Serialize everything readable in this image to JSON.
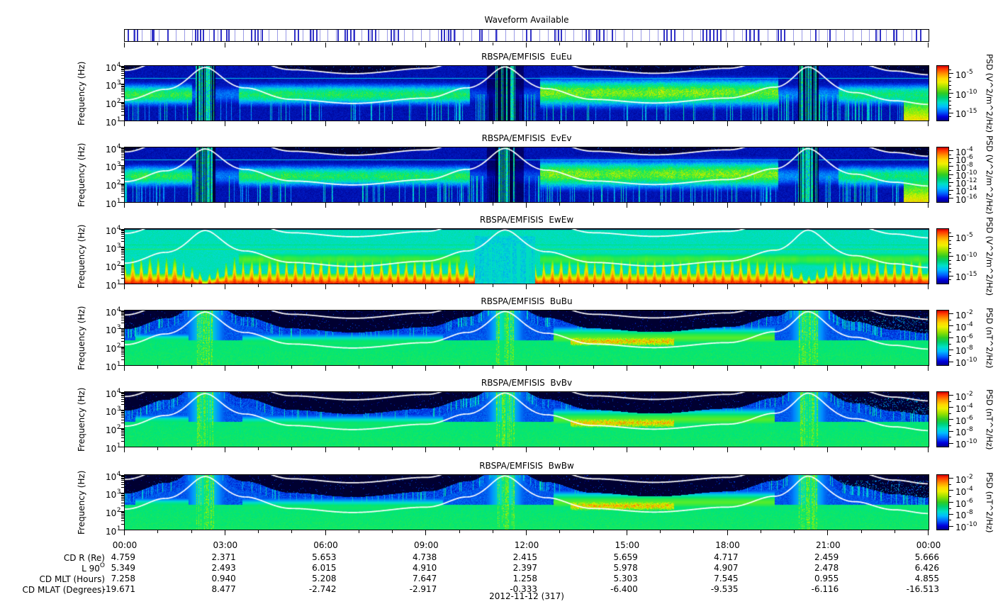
{
  "pow_base": "10",
  "waveform": {
    "title": "Waveform Available",
    "grid_color": "#9a9ae6",
    "mark_color": "#3434c8",
    "num_cells": 95,
    "marks": [
      0.004,
      0.012,
      0.016,
      0.034,
      0.036,
      0.054,
      0.088,
      0.091,
      0.094,
      0.098,
      0.111,
      0.12,
      0.127,
      0.13,
      0.158,
      0.162,
      0.166,
      0.171,
      0.212,
      0.216,
      0.231,
      0.235,
      0.239,
      0.265,
      0.274,
      0.277,
      0.281,
      0.286,
      0.303,
      0.308,
      0.312,
      0.332,
      0.335,
      0.34,
      0.394,
      0.398,
      0.403,
      0.406,
      0.41,
      0.442,
      0.444,
      0.462,
      0.5,
      0.505,
      0.535,
      0.54,
      0.543,
      0.574,
      0.578,
      0.587,
      0.591,
      0.596,
      0.607,
      0.671,
      0.675,
      0.68,
      0.684,
      0.72,
      0.724,
      0.728,
      0.733,
      0.737,
      0.742,
      0.773,
      0.778,
      0.783,
      0.788,
      0.813,
      0.817,
      0.821,
      0.86,
      0.877,
      0.935,
      0.94,
      0.957,
      0.96,
      0.985,
      0.99
    ]
  },
  "freq_axis": {
    "label": "Frequency (Hz)",
    "ticks": [
      {
        "base": "10",
        "exp": "4"
      },
      {
        "base": "10",
        "exp": "3"
      },
      {
        "base": "10",
        "exp": "2"
      },
      {
        "base": "10",
        "exp": "1"
      }
    ]
  },
  "time_axis": {
    "labels": [
      "00:00",
      "03:00",
      "06:00",
      "09:00",
      "12:00",
      "15:00",
      "18:00",
      "21:00",
      "00:00"
    ]
  },
  "chart_data": {
    "type": "heatmap",
    "description": "Stack of six RBSP-A EMFISIS wave power spectral density spectrograms vs time (00:00-24:00 UT) and log frequency (10 Hz - 10 kHz), with a waveform-availability event strip on top and spacecraft ephemeris rows below the time axis.",
    "x_range_hours": [
      0,
      24
    ],
    "date": "2012-11-12 (317)",
    "overlay_curves": {
      "description": "white curves: electron cyclotron frequency fce and lower-hybrid frequency fce/43",
      "fce_coeff_hz": 873600,
      "flh_ratio": 43,
      "L_control_points": [
        [
          0,
          5.349
        ],
        [
          1.2,
          3.4
        ],
        [
          2.4,
          1.35
        ],
        [
          3.6,
          3.2
        ],
        [
          5.0,
          5.2
        ],
        [
          6.8,
          6.15
        ],
        [
          9.0,
          4.91
        ],
        [
          10.2,
          3.2
        ],
        [
          11.35,
          1.32
        ],
        [
          12.6,
          3.3
        ],
        [
          14.0,
          5.2
        ],
        [
          15.8,
          6.05
        ],
        [
          18.0,
          4.907
        ],
        [
          19.4,
          3.1
        ],
        [
          20.4,
          1.33
        ],
        [
          21.8,
          3.9
        ],
        [
          23.0,
          5.5
        ],
        [
          24.0,
          6.426
        ]
      ]
    },
    "events": {
      "perigee_hours": [
        2.4,
        11.35,
        20.4
      ],
      "enhanced_wave_patch_hours": [
        13.0,
        19.3
      ]
    },
    "panels": [
      {
        "type": "heatmap",
        "title": "RBSPA/EMFISIS  EuEu",
        "instrument": "RBSPA/EMFISIS",
        "component": "EuEu",
        "ylabel": "Frequency (Hz)",
        "yscale": "log",
        "ylim_hz": [
          10,
          10000
        ],
        "style": "E",
        "seed": 11,
        "colorbar": {
          "label": "PSD (V^2/m^2/Hz)",
          "tick_exps": [
            "-5",
            "-10",
            "-15"
          ],
          "tick_pos": [
            0.14,
            0.5,
            0.86
          ]
        },
        "features": "dark-blue background; diffuse green band ~60-800 Hz, brightest 12:30-19:30; black above fce; narrow cyan line near 2.1 kHz; broadband vertical bursts and dropout near perigee passes"
      },
      {
        "type": "heatmap",
        "title": "RBSPA/EMFISIS  EvEv",
        "instrument": "RBSPA/EMFISIS",
        "component": "EvEv",
        "ylabel": "Frequency (Hz)",
        "yscale": "log",
        "ylim_hz": [
          10,
          10000
        ],
        "style": "E",
        "seed": 23,
        "colorbar": {
          "label": "PSD (V^2/m^2/Hz)",
          "tick_exps": [
            "-4",
            "-6",
            "-8",
            "-10",
            "-12",
            "-14",
            "-16"
          ],
          "tick_pos": [
            0.06,
            0.205,
            0.35,
            0.495,
            0.64,
            0.785,
            0.93
          ]
        },
        "features": "same morphology as EuEu"
      },
      {
        "type": "heatmap",
        "title": "RBSPA/EMFISIS  EwEw",
        "instrument": "RBSPA/EMFISIS",
        "component": "EwEw",
        "ylabel": "Frequency (Hz)",
        "yscale": "log",
        "ylim_hz": [
          10,
          10000
        ],
        "style": "Ew",
        "seed": 37,
        "colorbar": {
          "label": "PSD (V^2/m^2/Hz)",
          "tick_exps": [
            "-5",
            "-10",
            "-15"
          ],
          "tick_pos": [
            0.14,
            0.5,
            0.86
          ]
        },
        "features": "elevated cyan background; intense red/orange spiky band below ~200 Hz interrupted around perigee passes; green band 100-600 Hz; thin green lines near 800 Hz and 1.3 kHz"
      },
      {
        "type": "heatmap",
        "title": "RBSPA/EMFISIS  BuBu",
        "instrument": "RBSPA/EMFISIS",
        "component": "BuBu",
        "ylabel": "Frequency (Hz)",
        "yscale": "log",
        "ylim_hz": [
          10,
          10000
        ],
        "style": "B",
        "seed": 51,
        "colorbar": {
          "label": "PSD (nT^2/Hz)",
          "tick_exps": [
            "-2",
            "-4",
            "-6",
            "-8",
            "-10"
          ],
          "tick_pos": [
            0.06,
            0.28,
            0.5,
            0.72,
            0.94
          ]
        },
        "features": "black above ~fce/6; blue noise band below; steady green emission below ~200 Hz; enhanced yellow-green patch 100-1000 Hz from 13:00-19:20; broadband bursts at perigee"
      },
      {
        "type": "heatmap",
        "title": "RBSPA/EMFISIS  BvBv",
        "instrument": "RBSPA/EMFISIS",
        "component": "BvBv",
        "ylabel": "Frequency (Hz)",
        "yscale": "log",
        "ylim_hz": [
          10,
          10000
        ],
        "style": "B",
        "seed": 63,
        "colorbar": {
          "label": "PSD (nT^2/Hz)",
          "tick_exps": [
            "-2",
            "-4",
            "-6",
            "-8",
            "-10"
          ],
          "tick_pos": [
            0.06,
            0.28,
            0.5,
            0.72,
            0.94
          ]
        },
        "features": "same morphology as BuBu"
      },
      {
        "type": "heatmap",
        "title": "RBSPA/EMFISIS  BwBw",
        "instrument": "RBSPA/EMFISIS",
        "component": "BwBw",
        "ylabel": "Frequency (Hz)",
        "yscale": "log",
        "ylim_hz": [
          10,
          10000
        ],
        "style": "B",
        "seed": 77,
        "colorbar": {
          "label": "PSD (nT^2/Hz)",
          "tick_exps": [
            "-2",
            "-4",
            "-6",
            "-8",
            "-10"
          ],
          "tick_pos": [
            0.06,
            0.28,
            0.5,
            0.72,
            0.94
          ]
        },
        "features": "same morphology as BuBu"
      }
    ]
  },
  "ephemeris": {
    "rows": [
      {
        "label": "CD R (Re)",
        "sup": "",
        "values": [
          "4.759",
          "2.371",
          "5.653",
          "4.738",
          "2.415",
          "5.659",
          "4.717",
          "2.459",
          "5.666"
        ]
      },
      {
        "label": "L 90",
        "sup": "O",
        "values": [
          "5.349",
          "2.493",
          "6.015",
          "4.910",
          "2.397",
          "5.978",
          "4.907",
          "2.478",
          "6.426"
        ]
      },
      {
        "label": "CD MLT (Hours)",
        "sup": "",
        "values": [
          "7.258",
          "0.940",
          "5.208",
          "7.647",
          "1.258",
          "5.303",
          "7.545",
          "0.955",
          "4.855"
        ]
      },
      {
        "label": "CD MLAT (Degrees)",
        "sup": "",
        "values": [
          "-19.671",
          "8.477",
          "-2.742",
          "-2.917",
          "-0.333",
          "-6.400",
          "-9.535",
          "-6.116",
          "-16.513"
        ]
      }
    ],
    "date_label": "2012-11-12 (317)"
  }
}
